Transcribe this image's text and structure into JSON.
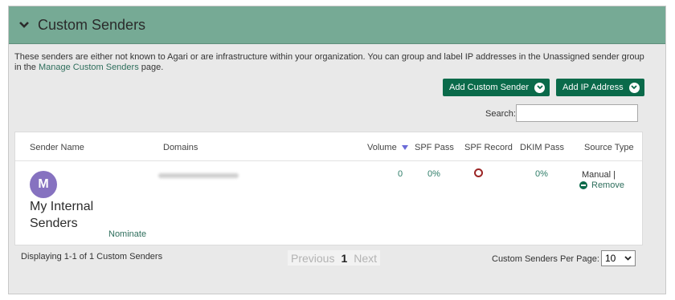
{
  "panel": {
    "title": "Custom Senders",
    "description_prefix": "These senders are either not known to Agari or are infrastructure within your organization. You can group and label IP addresses in the Unassigned sender group in the ",
    "description_link": "Manage Custom Senders",
    "description_suffix": " page."
  },
  "buttons": {
    "add_custom_sender": "Add Custom Sender",
    "add_ip_address": "Add IP Address"
  },
  "search": {
    "label": "Search:",
    "value": ""
  },
  "table": {
    "columns": [
      "Sender Name",
      "Domains",
      "Volume",
      "SPF Pass",
      "SPF Record",
      "DKIM Pass",
      "Source Type"
    ],
    "rows": [
      {
        "avatar_letter": "M",
        "sender_name": "My Internal Senders",
        "nominate": "Nominate",
        "volume": "0",
        "spf_pass": "0%",
        "dkim_pass": "0%",
        "source_type": "Manual  |",
        "remove": "Remove"
      }
    ]
  },
  "footer": {
    "displaying": "Displaying 1-1 of 1 Custom Senders",
    "previous": "Previous",
    "current_page": "1",
    "next": "Next",
    "per_page_label": "Custom Senders Per Page:",
    "per_page_value": "10"
  },
  "colors": {
    "header_bg": "#76aa95",
    "button_bg": "#0a6a4a",
    "avatar_bg": "#8672c0",
    "link": "#2e6e5c"
  }
}
